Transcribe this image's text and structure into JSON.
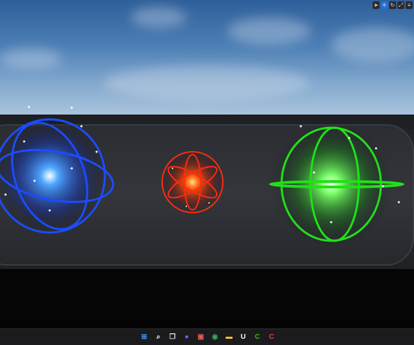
{
  "viewport": {
    "toolbar": [
      {
        "icon": "select-arrow-icon",
        "glyph": "➤",
        "active": false
      },
      {
        "icon": "move-icon",
        "glyph": "✛",
        "active": true
      },
      {
        "icon": "rotate-icon",
        "glyph": "↻",
        "active": false
      },
      {
        "icon": "scale-icon",
        "glyph": "⤢",
        "active": false
      },
      {
        "icon": "more-icon",
        "glyph": "≡",
        "active": false
      }
    ],
    "orbs": [
      {
        "name": "blue-orb",
        "color": "#1a4dff"
      },
      {
        "name": "red-orb",
        "color": "#ff2a10"
      },
      {
        "name": "green-orb",
        "color": "#22e01a"
      }
    ]
  },
  "taskbar": {
    "items": [
      {
        "icon": "windows-start-icon",
        "glyph": "⊞",
        "color": "#3aa0ff"
      },
      {
        "icon": "search-icon",
        "glyph": "⌕",
        "color": "#ffffff"
      },
      {
        "icon": "task-view-icon",
        "glyph": "❐",
        "color": "#dddddd"
      },
      {
        "icon": "chat-icon",
        "glyph": "●",
        "color": "#7b61ff"
      },
      {
        "icon": "app-icon",
        "glyph": "▣",
        "color": "#e8584a"
      },
      {
        "icon": "chrome-icon",
        "glyph": "◉",
        "color": "#34a853"
      },
      {
        "icon": "file-explorer-icon",
        "glyph": "▬",
        "color": "#f4c232"
      },
      {
        "icon": "unreal-engine-icon",
        "glyph": "U",
        "color": "#ffffff"
      },
      {
        "icon": "app-green-c-icon",
        "glyph": "C",
        "color": "#4caf1a"
      },
      {
        "icon": "app-red-c-icon",
        "glyph": "C",
        "color": "#e8403a"
      }
    ]
  }
}
